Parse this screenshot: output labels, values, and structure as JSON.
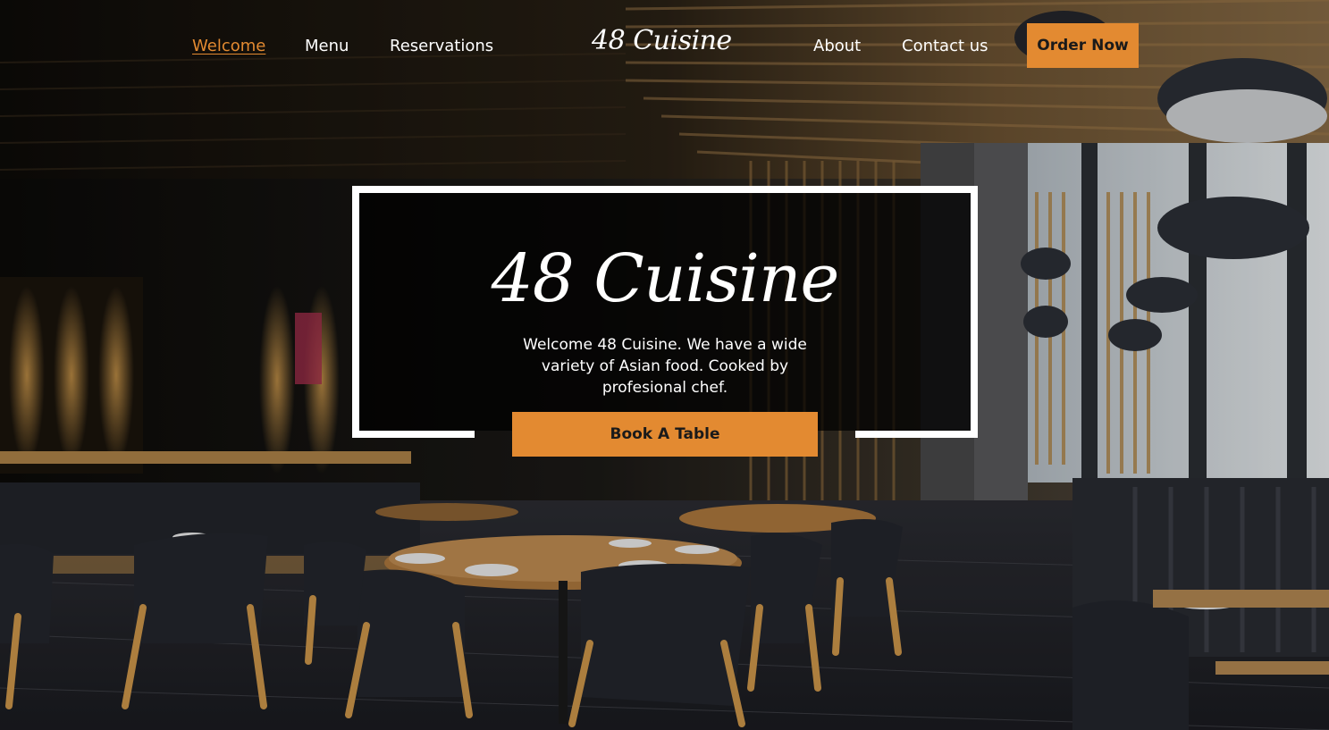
{
  "nav": {
    "links": [
      {
        "label": "Welcome",
        "active": true
      },
      {
        "label": "Menu",
        "active": false
      },
      {
        "label": "Reservations",
        "active": false
      },
      {
        "label": "About",
        "active": false
      },
      {
        "label": "Contact us",
        "active": false
      }
    ],
    "logo": "48 Cuisine",
    "order_button": "Order Now"
  },
  "hero": {
    "title": "48 Cuisine",
    "description": "Welcome 48 Cuisine. We have a wide variety of Asian food. Cooked by profesional chef.",
    "book_button": "Book A Table"
  },
  "colors": {
    "accent": "#e38a31",
    "text": "#ffffff",
    "button_text": "#1a1a1a",
    "card_border": "#ffffff"
  }
}
